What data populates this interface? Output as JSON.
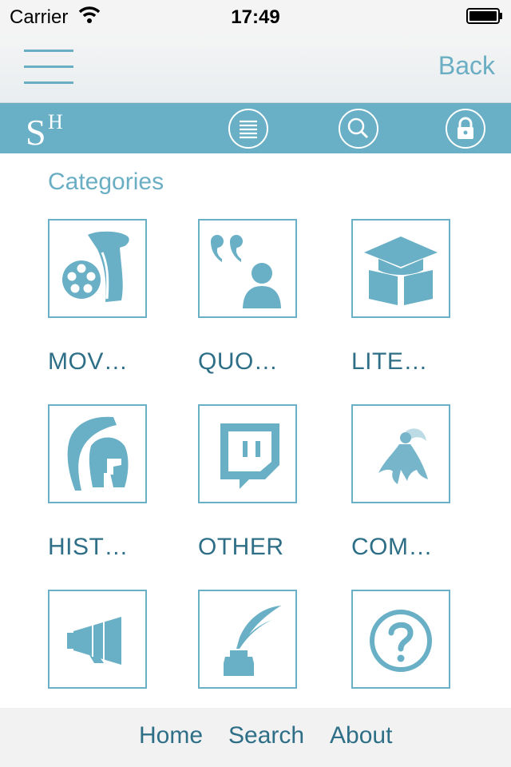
{
  "status_bar": {
    "carrier": "Carrier",
    "time": "17:49"
  },
  "nav_bar": {
    "back_label": "Back"
  },
  "brand": {
    "logo_text_main": "S",
    "logo_text_super": "H"
  },
  "main": {
    "section_title": "Categories",
    "categories": [
      {
        "label": "MOV…",
        "icon": "film-scroll-icon"
      },
      {
        "label": "QUO…",
        "icon": "quote-person-icon"
      },
      {
        "label": "LITE…",
        "icon": "graduation-book-icon"
      },
      {
        "label": "HIST…",
        "icon": "spartan-helmet-icon"
      },
      {
        "label": "OTHER",
        "icon": "chat-bubble-icon"
      },
      {
        "label": "COM…",
        "icon": "superhero-icon"
      },
      {
        "label": "",
        "icon": "megaphone-icon"
      },
      {
        "label": "",
        "icon": "quill-inkwell-icon"
      },
      {
        "label": "",
        "icon": "question-mark-icon"
      }
    ]
  },
  "tab_bar": {
    "home": "Home",
    "search": "Search",
    "about": "About"
  },
  "colors": {
    "accent": "#69afc5",
    "text_dark": "#2e6f87"
  }
}
